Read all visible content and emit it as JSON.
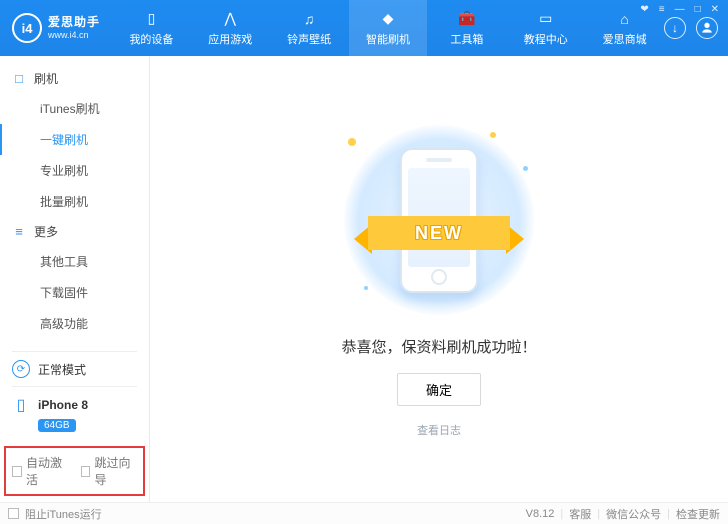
{
  "logo": {
    "mark": "i4",
    "brand": "爱思助手",
    "site": "www.i4.cn"
  },
  "header_tabs": [
    {
      "label": "我的设备",
      "icon": "phone-icon"
    },
    {
      "label": "应用游戏",
      "icon": "apps-icon"
    },
    {
      "label": "铃声壁纸",
      "icon": "music-icon"
    },
    {
      "label": "智能刷机",
      "icon": "flash-icon",
      "active": true
    },
    {
      "label": "工具箱",
      "icon": "toolbox-icon"
    },
    {
      "label": "教程中心",
      "icon": "book-icon"
    },
    {
      "label": "爱思商城",
      "icon": "shop-icon"
    }
  ],
  "win_icons": {
    "gift": "❤",
    "menu": "≡",
    "min": "—",
    "max": "□",
    "close": "✕"
  },
  "hdr_right": {
    "download": "↓",
    "user": "◯"
  },
  "sidebar": {
    "categories": [
      {
        "label": "刷机",
        "icon": "□",
        "items": [
          {
            "label": "iTunes刷机"
          },
          {
            "label": "一键刷机",
            "active": true
          },
          {
            "label": "专业刷机"
          },
          {
            "label": "批量刷机"
          }
        ]
      },
      {
        "label": "更多",
        "icon": "≡",
        "items": [
          {
            "label": "其他工具"
          },
          {
            "label": "下载固件"
          },
          {
            "label": "高级功能"
          }
        ]
      }
    ],
    "mode": {
      "label": "正常模式"
    },
    "device": {
      "name": "iPhone 8",
      "storage": "64GB"
    },
    "checkboxes": {
      "auto_activate": "自动激活",
      "skip_wizard": "跳过向导"
    }
  },
  "main": {
    "ribbon": "NEW",
    "message": "恭喜您，保资料刷机成功啦！",
    "ok": "确定",
    "view_log": "查看日志"
  },
  "footer": {
    "block_itunes": "阻止iTunes运行",
    "version": "V8.12",
    "support": "客服",
    "wechat": "微信公众号",
    "update": "检查更新"
  }
}
